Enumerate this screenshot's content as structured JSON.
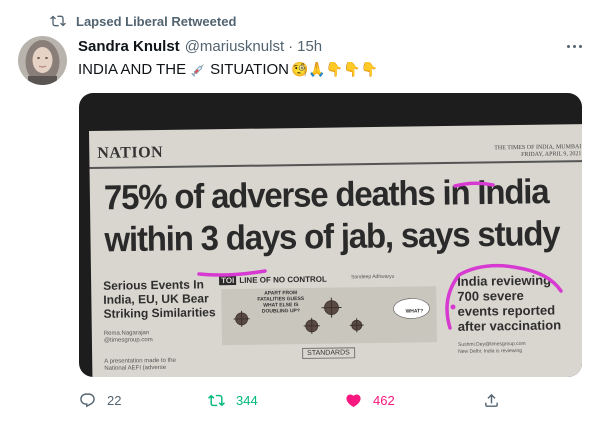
{
  "social_context": {
    "label": "Lapsed Liberal Retweeted",
    "icon": "retweet-icon"
  },
  "author": {
    "display_name": "Sandra Knulst",
    "handle": "@mariusknulst",
    "separator": "·",
    "time": "15h"
  },
  "tweet": {
    "text_before": "INDIA AND THE",
    "text_after": "SITUATION",
    "emojis": "🧐🙏👇👇👇",
    "syringe_icon": "syringe-icon"
  },
  "media": {
    "section": "NATION",
    "masthead": [
      "THE TIMES OF INDIA, MUMBAI",
      "FRIDAY, APRIL 9, 2021"
    ],
    "headline": [
      "75% of adverse deaths in India",
      "within 3 days of jab, says study"
    ],
    "left_story": [
      "Serious Events In",
      "India, EU, UK Bear",
      "Striking Similarities"
    ],
    "left_byline": [
      "Rema.Nagarajan",
      "@timesgroup.com"
    ],
    "left_foot": [
      "A presentation made to the",
      "National AEFI (adverse"
    ],
    "toi_mark": "TOI",
    "toi_title": "LINE OF NO CONTROL",
    "toi_byline": "Sandeep Adhwaryu",
    "cartoon_caption": [
      "APART FROM",
      "FATALITIES GUESS",
      "WHAT ELSE IS",
      "DOUBLING UP?"
    ],
    "cartoon_reply": "WHAT?",
    "standards": "STANDARDS",
    "right_story": [
      "India reviewing",
      "700 severe",
      "events reported",
      "after vaccination"
    ],
    "right_byline": [
      "Sushmi.Dey@timesgroup.com",
      "New Delhi: India is reviewing"
    ],
    "ink_color": "#d63ad0"
  },
  "actions": {
    "reply": {
      "count": "22",
      "icon": "reply-icon",
      "color": "#536471"
    },
    "retweet": {
      "count": "344",
      "icon": "retweet-icon",
      "color": "#00ba7c"
    },
    "like": {
      "count": "462",
      "icon": "heart-filled-icon",
      "color": "#f91880"
    },
    "share": {
      "icon": "share-icon",
      "color": "#536471"
    }
  },
  "more_icon": "more-horizontal-icon"
}
